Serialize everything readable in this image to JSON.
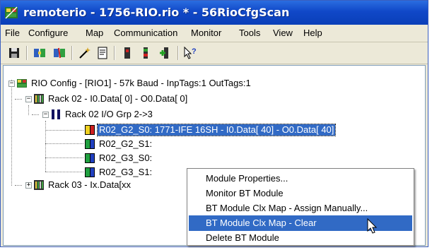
{
  "window": {
    "title": "remoterio - 1756-RIO.rio * - 56RioCfgScan"
  },
  "menu": [
    "File",
    "Configure",
    "Map",
    "Communication",
    "Monitor",
    "Tools",
    "View",
    "Help"
  ],
  "toolbar": [
    "save-icon",
    "connect-icon",
    "disconnect-icon",
    "wizard-icon",
    "document-icon",
    "module-red-icon",
    "module-green-icon",
    "module-add-icon",
    "help-pointer-icon"
  ],
  "tree": {
    "root": "RIO Config - [RIO1] - 57k Baud - InpTags:1 OutTags:1",
    "rack02": "Rack 02 - I0.Data[ 0] - O0.Data[ 0]",
    "group": "Rack 02 I/O Grp 2->3",
    "modules": [
      "R02_G2_S0: 1771-IFE 16SH - I0.Data[ 40] - O0.Data[ 40]",
      "R02_G2_S1:",
      "R02_G3_S0:",
      "R02_G3_S1:"
    ],
    "rack03": "Rack 03 - Ix.Data[xx"
  },
  "context_menu": {
    "items": [
      "Module Properties...",
      "Monitor BT Module",
      "BT Module Clx Map - Assign Manually...",
      "BT Module Clx Map - Clear",
      "Delete BT Module"
    ],
    "highlighted_index": 3
  },
  "colors": {
    "title_bar": "#1048c8",
    "selection": "#316ac5",
    "chrome": "#ece9d8"
  }
}
